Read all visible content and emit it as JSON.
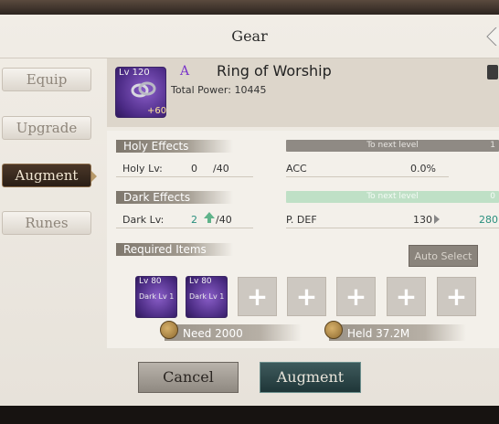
{
  "window": {
    "title": "Gear"
  },
  "tabs": [
    {
      "label": "Equip",
      "active": false
    },
    {
      "label": "Upgrade",
      "active": false
    },
    {
      "label": "Augment",
      "active": true
    },
    {
      "label": "Runes",
      "active": false
    }
  ],
  "item": {
    "level": "Lv 120",
    "plus": "+60",
    "grade": "A",
    "name": "Ring of Worship",
    "total_power": "Total Power: 10445"
  },
  "holy": {
    "section_label": "Holy Effects",
    "level_label": "Holy Lv:",
    "level_value": "0",
    "level_max": "/40",
    "bar_text": "To next level",
    "bar_right": "1",
    "stat_name": "ACC",
    "stat_value": "0.0%"
  },
  "dark": {
    "section_label": "Dark Effects",
    "level_label": "Dark Lv:",
    "level_value": "2",
    "level_max": "/40",
    "bar_text": "To next level",
    "bar_right": "0",
    "stat_name": "P. DEF",
    "stat_current": "130",
    "stat_next": "280"
  },
  "required": {
    "section_label": "Required Items",
    "auto_select_label": "Auto Select",
    "materials": [
      {
        "level": "Lv 80",
        "dark": "Dark Lv 1"
      },
      {
        "level": "Lv 80",
        "dark": "Dark Lv 1"
      }
    ],
    "empty_slot_symbol": "+",
    "need_label": "Need 2000",
    "held_label": "Held  37.2M"
  },
  "actions": {
    "cancel_label": "Cancel",
    "augment_label": "Augment"
  },
  "colors": {
    "accent_grade": "#7a35c9",
    "dark_next_value": "#2a8f7e",
    "up_arrow": "#5fb38a"
  }
}
